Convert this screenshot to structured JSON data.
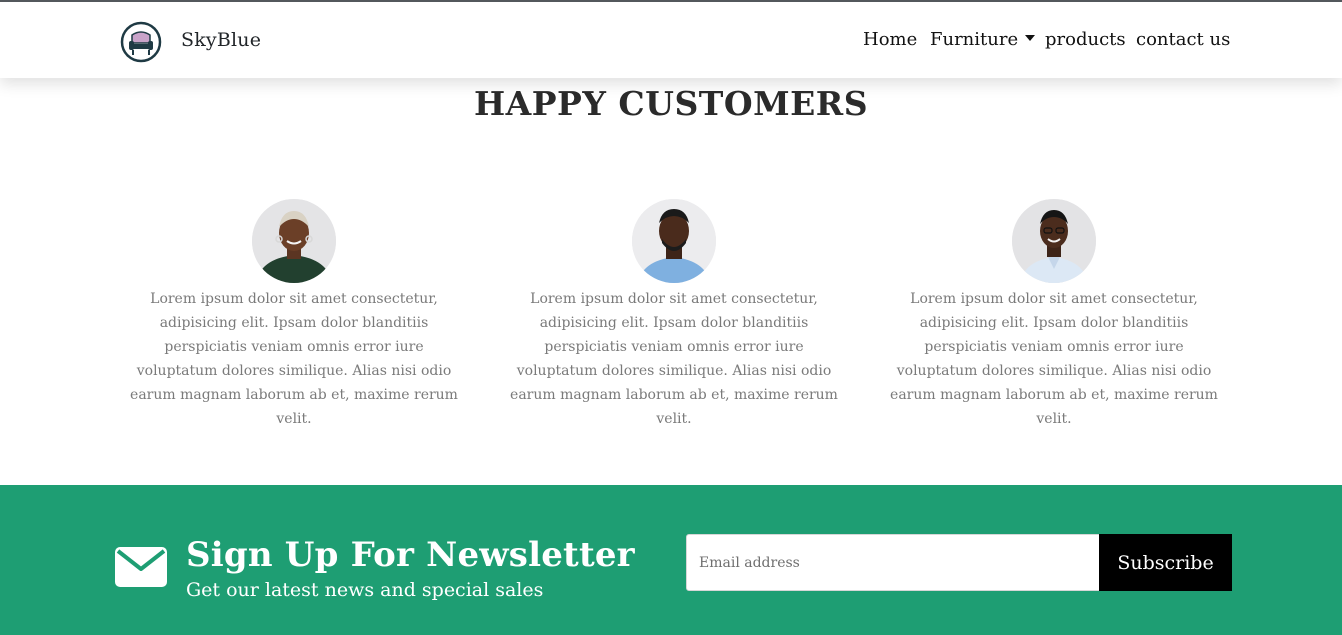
{
  "navbar": {
    "brand": "SkyBlue",
    "logo_icon": "armchair-logo-icon",
    "links": [
      {
        "label": "Home"
      },
      {
        "label": "Furniture",
        "has_dropdown": true
      },
      {
        "label": "products"
      },
      {
        "label": "contact us"
      }
    ]
  },
  "testimonials": {
    "title": "HAPPY CUSTOMERS",
    "items": [
      {
        "avatar": "customer-woman-avatar",
        "text": "Lorem ipsum dolor sit amet consectetur, adipisicing elit. Ipsam dolor blanditiis perspiciatis veniam omnis error iure voluptatum dolores similique. Alias nisi odio earum magnam laborum ab et, maxime rerum velit."
      },
      {
        "avatar": "customer-man-avatar",
        "text": "Lorem ipsum dolor sit amet consectetur, adipisicing elit. Ipsam dolor blanditiis perspiciatis veniam omnis error iure voluptatum dolores similique. Alias nisi odio earum magnam laborum ab et, maxime rerum velit."
      },
      {
        "avatar": "customer-man-glasses-avatar",
        "text": "Lorem ipsum dolor sit amet consectetur, adipisicing elit. Ipsam dolor blanditiis perspiciatis veniam omnis error iure voluptatum dolores similique. Alias nisi odio earum magnam laborum ab et, maxime rerum velit."
      }
    ]
  },
  "newsletter": {
    "title": "Sign Up For Newsletter",
    "subtitle": "Get our latest news and special sales",
    "email_placeholder": "Email address",
    "email_value": "",
    "button_label": "Subscribe",
    "background_color": "#1e9e73",
    "icon": "envelope-icon"
  }
}
